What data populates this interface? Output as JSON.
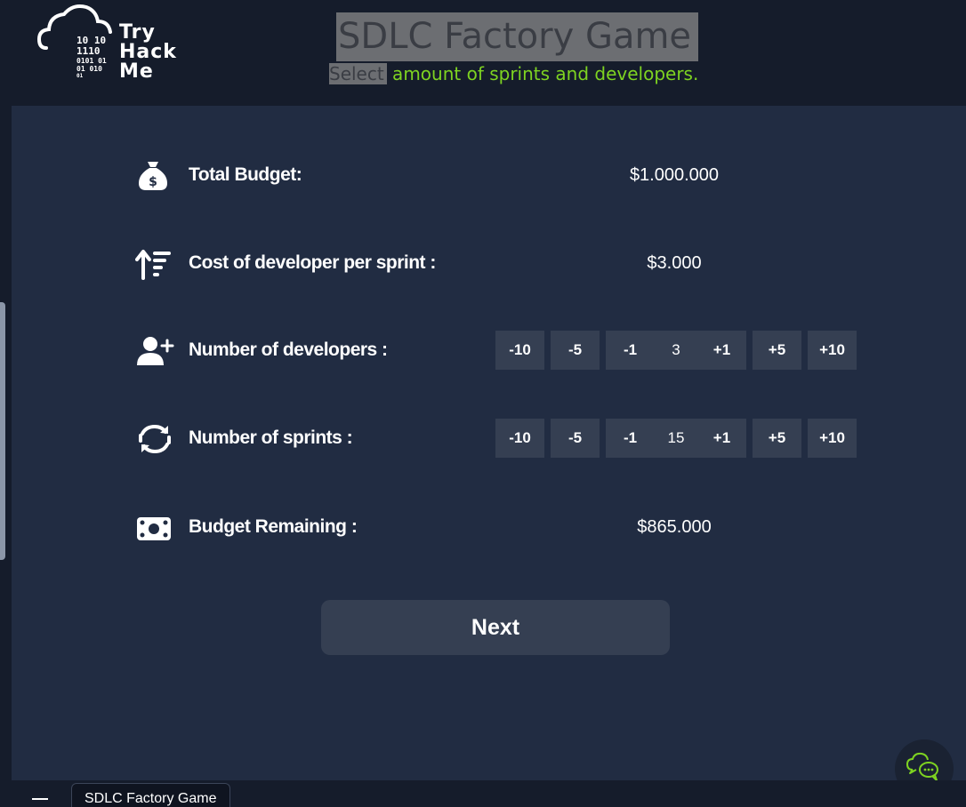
{
  "header": {
    "logo": {
      "bits": [
        "10  10",
        "1110",
        "0101  01",
        "01  010",
        "01"
      ],
      "words": [
        "Try",
        "Hack",
        "Me"
      ]
    },
    "title": "SDLC Factory Game",
    "subtitle_selected": "Select",
    "subtitle_rest": " amount of sprints and developers."
  },
  "rows": {
    "total_budget": {
      "icon": "money-bag-icon",
      "label": "Total Budget:",
      "value": "$1.000.000"
    },
    "cost_per_sprint": {
      "icon": "sort-up-icon",
      "label": "Cost of developer per sprint :",
      "value": "$3.000"
    },
    "developers": {
      "icon": "user-plus-icon",
      "label": "Number of developers :",
      "value": "3"
    },
    "sprints": {
      "icon": "refresh-icon",
      "label": "Number of sprints :",
      "value": "15"
    },
    "budget_remaining": {
      "icon": "banknote-icon",
      "label": "Budget Remaining :",
      "value": "$865.000"
    }
  },
  "stepper_buttons": {
    "m10": "-10",
    "m5": "-5",
    "m1": "-1",
    "p1": "+1",
    "p5": "+5",
    "p10": "+10"
  },
  "next_label": "Next",
  "taskbar": {
    "tab_label": "SDLC Factory Game"
  },
  "colors": {
    "accent": "#7ed321",
    "background": "#212c42",
    "header": "#151c2b",
    "button": "#353f52"
  }
}
